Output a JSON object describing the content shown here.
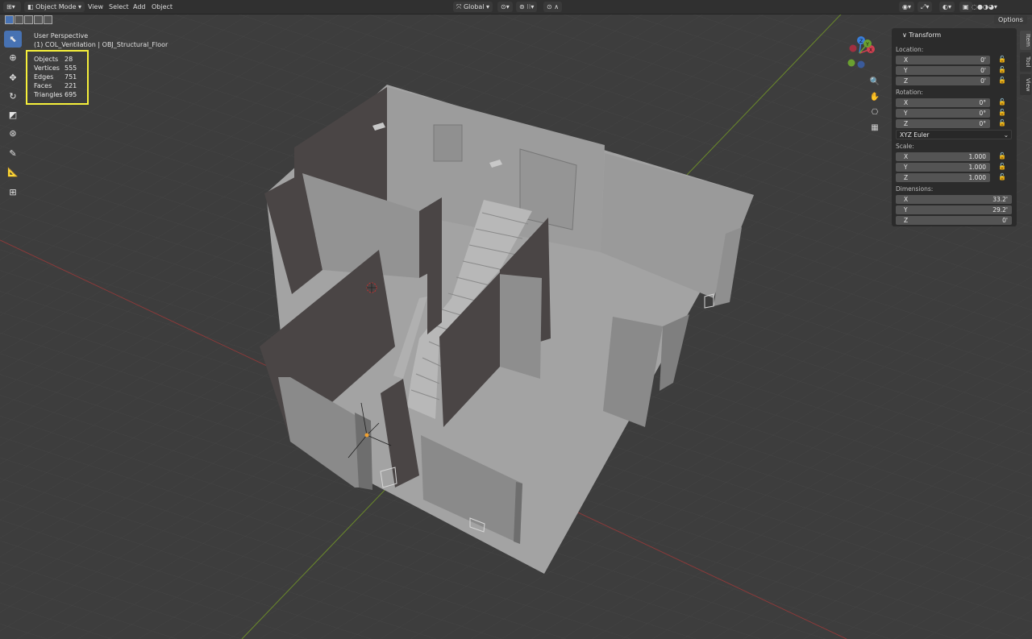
{
  "header": {
    "mode": "Object Mode",
    "menu": [
      "View",
      "Select",
      "Add",
      "Object"
    ],
    "transform_orientation": "Global",
    "options": "Options"
  },
  "viewport": {
    "view_name": "User Perspective",
    "collection_info": "(1) COL_Ventilation | OBJ_Structural_Floor"
  },
  "stats": [
    {
      "label": "Objects",
      "value": "28"
    },
    {
      "label": "Vertices",
      "value": "555"
    },
    {
      "label": "Edges",
      "value": "751"
    },
    {
      "label": "Faces",
      "value": "221"
    },
    {
      "label": "Triangles",
      "value": "695"
    }
  ],
  "gizmo": {
    "x": "X",
    "y": "Y",
    "z": "Z"
  },
  "tools": [
    "select-box-icon",
    "cursor-icon",
    "move-icon",
    "rotate-icon",
    "scale-icon",
    "transform-icon",
    "annotate-icon",
    "measure-icon",
    "add-cube-icon"
  ],
  "panel": {
    "title": "Transform",
    "location_label": "Location:",
    "location": [
      {
        "axis": "X",
        "value": "0'"
      },
      {
        "axis": "Y",
        "value": "0'"
      },
      {
        "axis": "Z",
        "value": "0'"
      }
    ],
    "rotation_label": "Rotation:",
    "rotation": [
      {
        "axis": "X",
        "value": "0°"
      },
      {
        "axis": "Y",
        "value": "0°"
      },
      {
        "axis": "Z",
        "value": "0°"
      }
    ],
    "rotation_mode": "XYZ Euler",
    "scale_label": "Scale:",
    "scale": [
      {
        "axis": "X",
        "value": "1.000"
      },
      {
        "axis": "Y",
        "value": "1.000"
      },
      {
        "axis": "Z",
        "value": "1.000"
      }
    ],
    "dimensions_label": "Dimensions:",
    "dimensions": [
      {
        "axis": "X",
        "value": "33.2'"
      },
      {
        "axis": "Y",
        "value": "29.2'"
      },
      {
        "axis": "Z",
        "value": "0'"
      }
    ]
  },
  "sidebar_tabs": [
    "Item",
    "Tool",
    "View"
  ],
  "colors": {
    "background": "#3d3d3d",
    "grid": "#474747",
    "x_axis": "#8b3a3a",
    "y_axis": "#6b8a2a",
    "highlight": "#f6f03a",
    "active_tool": "#4772b3"
  }
}
